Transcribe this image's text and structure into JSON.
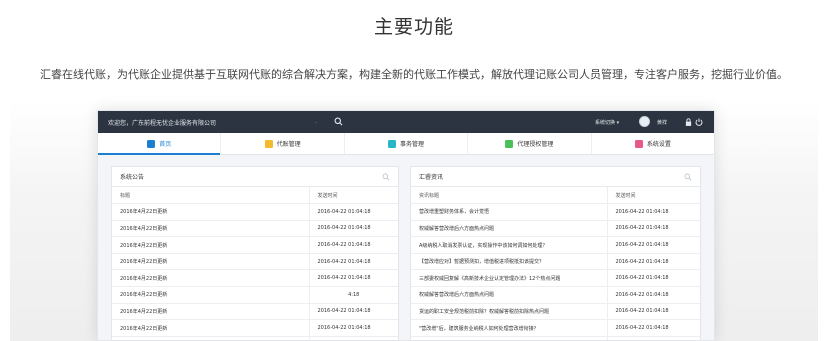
{
  "section": {
    "heading": "主要功能",
    "subtitle": "汇睿在线代账，为代账企业提供基于互联网代账的综合解决方案，构建全新的代账工作模式，解放代理记账公司人员管理，专注客户服务，挖掘行业价值。"
  },
  "app": {
    "topbar": {
      "welcome": "欢迎您，广东前程无忧企业服务有限公司",
      "dot": ".",
      "system_switch": "系统切换 ▾",
      "user_name": "黄祥"
    },
    "tabs": [
      {
        "label": "首页",
        "icon": "home-icon",
        "color": "#1d7fd3",
        "active": true
      },
      {
        "label": "代账管理",
        "icon": "ledger-icon",
        "color": "#f5b92e",
        "active": false
      },
      {
        "label": "事务管理",
        "icon": "task-icon",
        "color": "#27b7c9",
        "active": false
      },
      {
        "label": "代理授权管理",
        "icon": "authorize-icon",
        "color": "#4cbe5a",
        "active": false
      },
      {
        "label": "系统设置",
        "icon": "settings-icon",
        "color": "#e8578a",
        "active": false
      }
    ],
    "notice_panel": {
      "title": "系统公告",
      "columns": [
        "标题",
        "发送时间"
      ],
      "rows": [
        [
          "2016年4月22日更新",
          "2016-04-22 01:04:18"
        ],
        [
          "2016年4月22日更新",
          "2016-04-22 01:04:18"
        ],
        [
          "2016年4月22日更新",
          "2016-04-22 01:04:18"
        ],
        [
          "2016年4月22日更新",
          "2016-04-22 01:04:18"
        ],
        [
          "2016年4月22日更新",
          "2016-04-22 01:04:18"
        ],
        [
          "2016年4月22日更新",
          "4:18"
        ],
        [
          "2016年4月22日更新",
          "2016-04-22 01:04:18"
        ],
        [
          "2016年4月22日更新",
          "2016-04-22 01:04:18"
        ],
        [
          "2016年4月22日更新",
          "2016-04-22 01:04:18"
        ]
      ]
    },
    "news_panel": {
      "title": "汇睿资讯",
      "columns": [
        "资讯标题",
        "发送时间"
      ],
      "rows": [
        [
          "营改增重塑财务体系，会计觉悟",
          "2016-04-22 01:04:18"
        ],
        [
          "权威解答营改增后六方面热点问题",
          "2016-04-22 01:04:18"
        ],
        [
          "A级纳税人取消发票认证，实现操作中该如何调如何处理？",
          "2016-04-22 01:04:18"
        ],
        [
          "【营改增应对】暂据预测扣，增值税进项税抵扣该提交？",
          "2016-04-22 01:04:18"
        ],
        [
          "三部委权威回复解《高新技术企业认定管理办法》12个热点问题",
          "2016-04-22 01:04:18"
        ],
        [
          "权威解答营改增后六方面热点问题",
          "2016-04-22 01:04:18"
        ],
        [
          "货运的职工安全规范税前扣除？权威解答税前扣除热点问题",
          "2016-04-22 01:04:18"
        ],
        [
          "\"营改增\"后，建筑服务业纳税人如何处理营改增衔接？",
          "2016-04-22 01:04:18"
        ],
        [
          "权威解答营改增后六方面热点问题",
          "2016-04-22 01:04:18"
        ]
      ]
    }
  }
}
